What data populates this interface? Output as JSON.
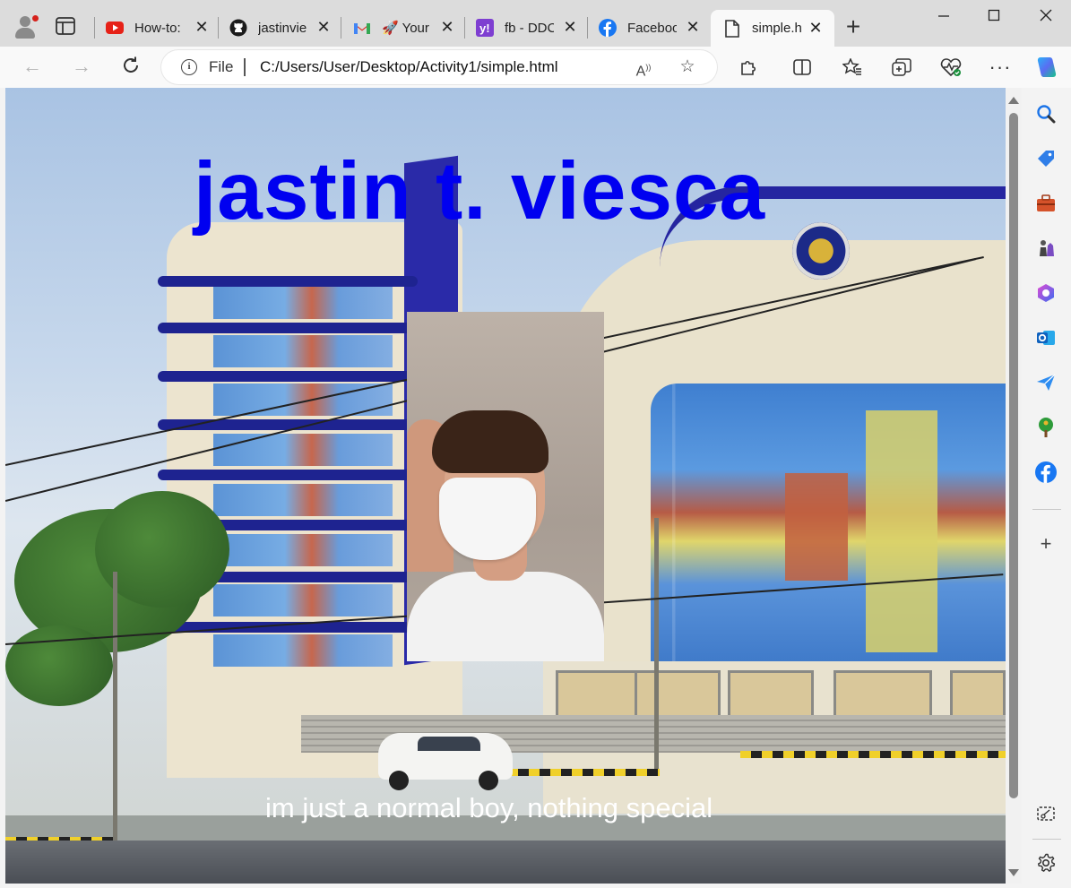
{
  "browser": {
    "tabs": [
      {
        "label": "How-to:",
        "icon": "youtube-icon"
      },
      {
        "label": "jastinvie",
        "icon": "github-icon"
      },
      {
        "label": "🚀 Your",
        "icon": "gmail-icon"
      },
      {
        "label": "fb - DDC",
        "icon": "yahoo-icon"
      },
      {
        "label": "Faceboo",
        "icon": "facebook-icon"
      },
      {
        "label": "simple.h",
        "icon": "document-icon",
        "active": true
      }
    ],
    "address": {
      "scheme_label": "File",
      "url": "C:/Users/User/Desktop/Activity1/simple.html"
    }
  },
  "page": {
    "title": "jastin t. viesca",
    "caption": "im just a normal boy, nothing special"
  },
  "colors": {
    "title": "#0000f0",
    "caption": "#ffffff",
    "accent_blue": "#1e2390"
  }
}
